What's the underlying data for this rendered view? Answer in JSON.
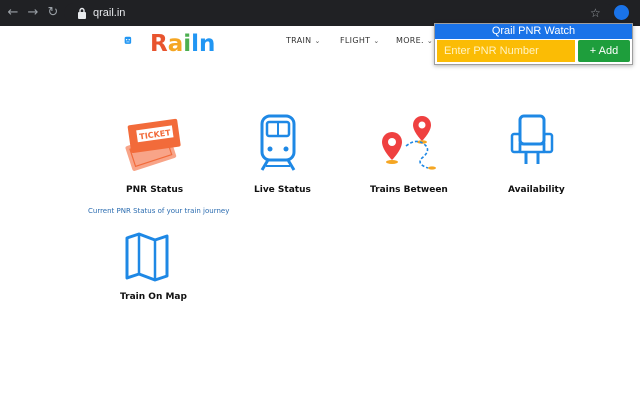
{
  "browser": {
    "url": "qrail.in",
    "back_icon": "back-arrow-icon",
    "forward_icon": "forward-arrow-icon",
    "reload_icon": "reload-icon"
  },
  "site": {
    "logo_text": [
      "R",
      "a",
      "i",
      "l",
      "n"
    ],
    "nav": {
      "train": "TRAIN",
      "flight": "FLIGHT",
      "more": "MORE."
    }
  },
  "popup": {
    "title": "Qrail PNR Watch",
    "input_placeholder": "Enter PNR Number",
    "add_label": "+ Add"
  },
  "services": {
    "pnr_status": "PNR Status",
    "live_status": "Live Status",
    "trains_between": "Trains Between",
    "availability": "Availability",
    "train_on_map": "Train On Map"
  },
  "tooltip": "Current PNR Status of your train journey",
  "icons": {
    "ticket_label": "TICKET"
  },
  "colors": {
    "popup_header": "#1a73e8",
    "input_bg": "#fbbc05",
    "add_button": "#1e9e3c",
    "icon_blue": "#1e88e5",
    "ticket_orange": "#f26b3a",
    "pin_red": "#ef4040"
  }
}
